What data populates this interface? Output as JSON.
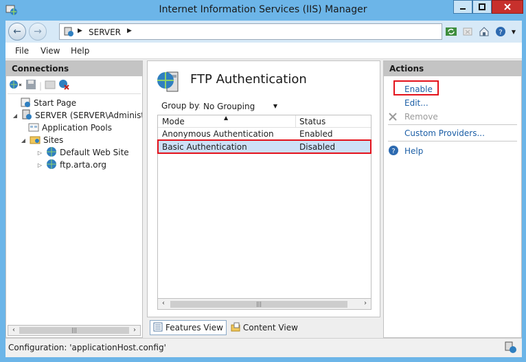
{
  "window": {
    "title": "Internet Information Services (IIS) Manager"
  },
  "address": {
    "crumbs": [
      "SERVER"
    ]
  },
  "menu": {
    "items": [
      "File",
      "View",
      "Help"
    ]
  },
  "connections": {
    "title": "Connections",
    "tree": [
      {
        "label": "Start Page",
        "icon": "start-page-icon"
      },
      {
        "label": "SERVER (SERVER\\Administrato",
        "icon": "server-icon"
      },
      {
        "label": "Application Pools",
        "icon": "app-pools-icon"
      },
      {
        "label": "Sites",
        "icon": "sites-folder-icon"
      },
      {
        "label": "Default Web Site",
        "icon": "globe-icon"
      },
      {
        "label": "ftp.arta.org",
        "icon": "globe-icon"
      }
    ]
  },
  "feature": {
    "title": "FTP Authentication",
    "group_by_label": "Group by:",
    "group_by_value": "No Grouping",
    "columns": [
      "Mode",
      "Status"
    ],
    "rows": [
      {
        "mode": "Anonymous Authentication",
        "status": "Enabled"
      },
      {
        "mode": "Basic Authentication",
        "status": "Disabled"
      }
    ],
    "selected_row": 1
  },
  "views": {
    "features": "Features View",
    "content": "Content View"
  },
  "actions": {
    "title": "Actions",
    "enable": "Enable",
    "edit": "Edit...",
    "remove": "Remove",
    "custom_providers": "Custom Providers...",
    "help": "Help"
  },
  "status": {
    "text": "Configuration: 'applicationHost.config'"
  },
  "colors": {
    "titlebar": "#6cb5e8",
    "link": "#1b5ea6",
    "highlight": "#e3101a",
    "selection": "#cde0f7"
  }
}
